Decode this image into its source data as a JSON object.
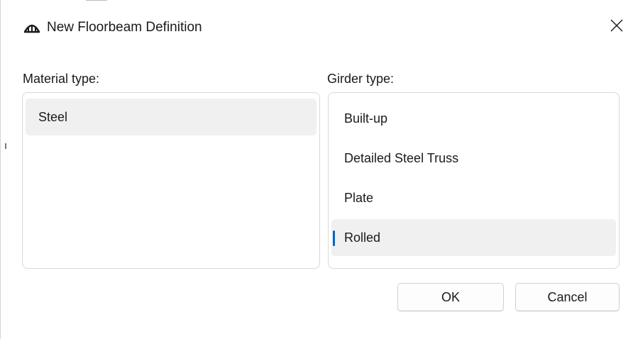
{
  "dialog": {
    "title": "New Floorbeam Definition",
    "app_icon": "bridge-arch-icon",
    "close_icon": "close-icon",
    "close_glyph": "✕"
  },
  "material": {
    "label": "Material type:",
    "items": [
      {
        "label": "Steel",
        "selected": true
      }
    ]
  },
  "girder": {
    "label": "Girder type:",
    "items": [
      {
        "label": "Built-up",
        "selected": false
      },
      {
        "label": "Detailed Steel Truss",
        "selected": false
      },
      {
        "label": "Plate",
        "selected": false
      },
      {
        "label": "Rolled",
        "selected": true
      }
    ]
  },
  "buttons": {
    "ok_label": "OK",
    "cancel_label": "Cancel"
  },
  "colors": {
    "accent": "#0067c0",
    "selected_bg": "#f0f0f0",
    "border": "#d9d9d9"
  }
}
